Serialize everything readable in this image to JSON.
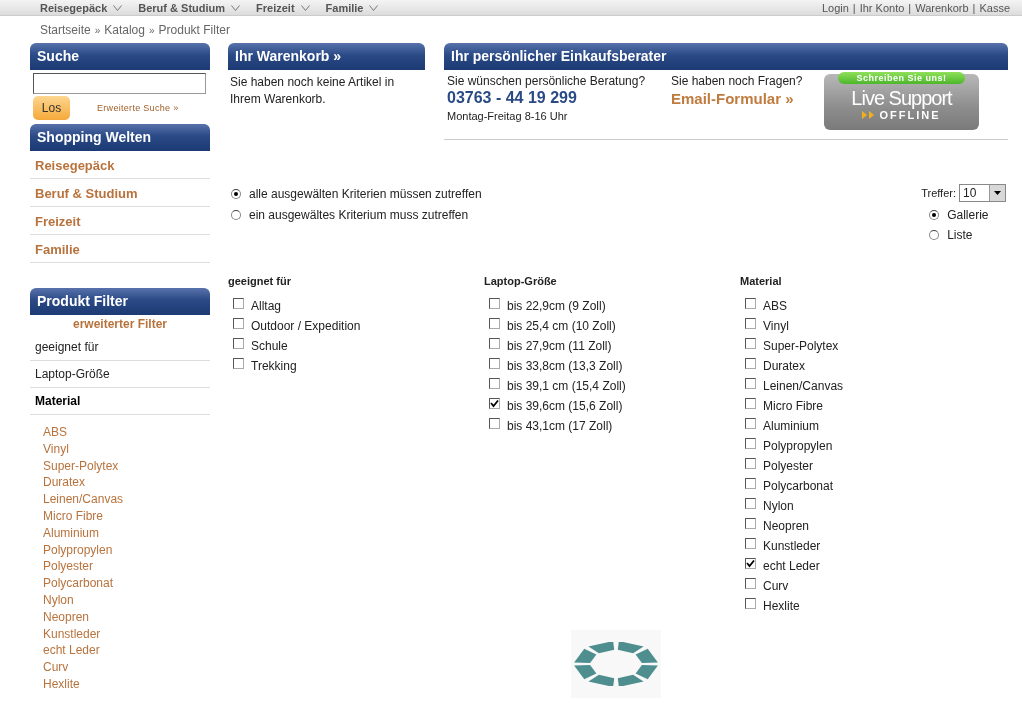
{
  "top_nav": {
    "categories": [
      {
        "label": "Reisegepäck"
      },
      {
        "label": "Beruf & Studium"
      },
      {
        "label": "Freizeit"
      },
      {
        "label": "Familie"
      }
    ],
    "account_links": [
      "Login",
      "Ihr Konto",
      "Warenkorb",
      "Kasse"
    ],
    "separator": "|"
  },
  "breadcrumb": {
    "items": [
      "Startseite",
      "Katalog",
      "Produkt Filter"
    ],
    "separator": "»"
  },
  "search": {
    "title": "Suche",
    "button": "Los",
    "advanced_link": "Erweiterte Suche »"
  },
  "shopping_worlds": {
    "title": "Shopping Welten",
    "items": [
      "Reisegepäck",
      "Beruf & Studium",
      "Freizeit",
      "Familie"
    ]
  },
  "product_filter": {
    "title": "Produkt Filter",
    "advanced_filter": "erweiterter Filter",
    "groups": [
      {
        "label": "geeignet für",
        "selected": false
      },
      {
        "label": "Laptop-Größe",
        "selected": false
      },
      {
        "label": "Material",
        "selected": true
      }
    ],
    "values": [
      "ABS",
      "Vinyl",
      "Super-Polytex",
      "Duratex",
      "Leinen/Canvas",
      "Micro Fibre",
      "Aluminium",
      "Polypropylen",
      "Polyester",
      "Polycarbonat",
      "Nylon",
      "Neopren",
      "Kunstleder",
      "echt Leder",
      "Curv",
      "Hexlite"
    ]
  },
  "cart": {
    "title": "Ihr Warenkorb »",
    "message": "Sie haben noch keine Artikel in Ihrem Warenkorb."
  },
  "advisor": {
    "title": "Ihr persönlicher Einkaufsberater",
    "consult_question": "Sie wünschen persönliche Beratung?",
    "phone": "03763 - 44 19 299",
    "hours": "Montag-Freitag 8-16 Uhr",
    "contact_question": "Sie haben noch Fragen?",
    "email_link": "Email-Formular »",
    "live_support": {
      "ribbon": "Schreiben Sie uns!",
      "title": "Live Support",
      "status": "OFFLINE"
    }
  },
  "match_mode": [
    {
      "label": "alle ausgewälten Kriterien müssen zutreffen",
      "selected": true
    },
    {
      "label": "ein ausgewältes Kriterium muss zutreffen",
      "selected": false
    }
  ],
  "results": {
    "label": "Treffer:",
    "value": "10"
  },
  "view_mode": [
    {
      "label": "Gallerie",
      "selected": true
    },
    {
      "label": "Liste",
      "selected": false
    }
  ],
  "filter_columns": [
    {
      "title": "geeignet für",
      "options": [
        {
          "label": "Alltag",
          "checked": false
        },
        {
          "label": "Outdoor / Expedition",
          "checked": false
        },
        {
          "label": "Schule",
          "checked": false
        },
        {
          "label": "Trekking",
          "checked": false
        }
      ]
    },
    {
      "title": "Laptop-Größe",
      "options": [
        {
          "label": "bis 22,9cm (9 Zoll)",
          "checked": false
        },
        {
          "label": "bis 25,4 cm (10 Zoll)",
          "checked": false
        },
        {
          "label": "bis 27,9cm (11 Zoll)",
          "checked": false
        },
        {
          "label": "bis 33,8cm (13,3 Zoll)",
          "checked": false
        },
        {
          "label": "bis 39,1 cm (15,4 Zoll)",
          "checked": false
        },
        {
          "label": "bis 39,6cm (15,6 Zoll)",
          "checked": true
        },
        {
          "label": "bis 43,1cm (17 Zoll)",
          "checked": false
        }
      ]
    },
    {
      "title": "Material",
      "options": [
        {
          "label": "ABS",
          "checked": false
        },
        {
          "label": "Vinyl",
          "checked": false
        },
        {
          "label": "Super-Polytex",
          "checked": false
        },
        {
          "label": "Duratex",
          "checked": false
        },
        {
          "label": "Leinen/Canvas",
          "checked": false
        },
        {
          "label": "Micro Fibre",
          "checked": false
        },
        {
          "label": "Aluminium",
          "checked": false
        },
        {
          "label": "Polypropylen",
          "checked": false
        },
        {
          "label": "Polyester",
          "checked": false
        },
        {
          "label": "Polycarbonat",
          "checked": false
        },
        {
          "label": "Nylon",
          "checked": false
        },
        {
          "label": "Neopren",
          "checked": false
        },
        {
          "label": "Kunstleder",
          "checked": false
        },
        {
          "label": "echt Leder",
          "checked": true
        },
        {
          "label": "Curv",
          "checked": false
        },
        {
          "label": "Hexlite",
          "checked": false
        }
      ]
    }
  ]
}
